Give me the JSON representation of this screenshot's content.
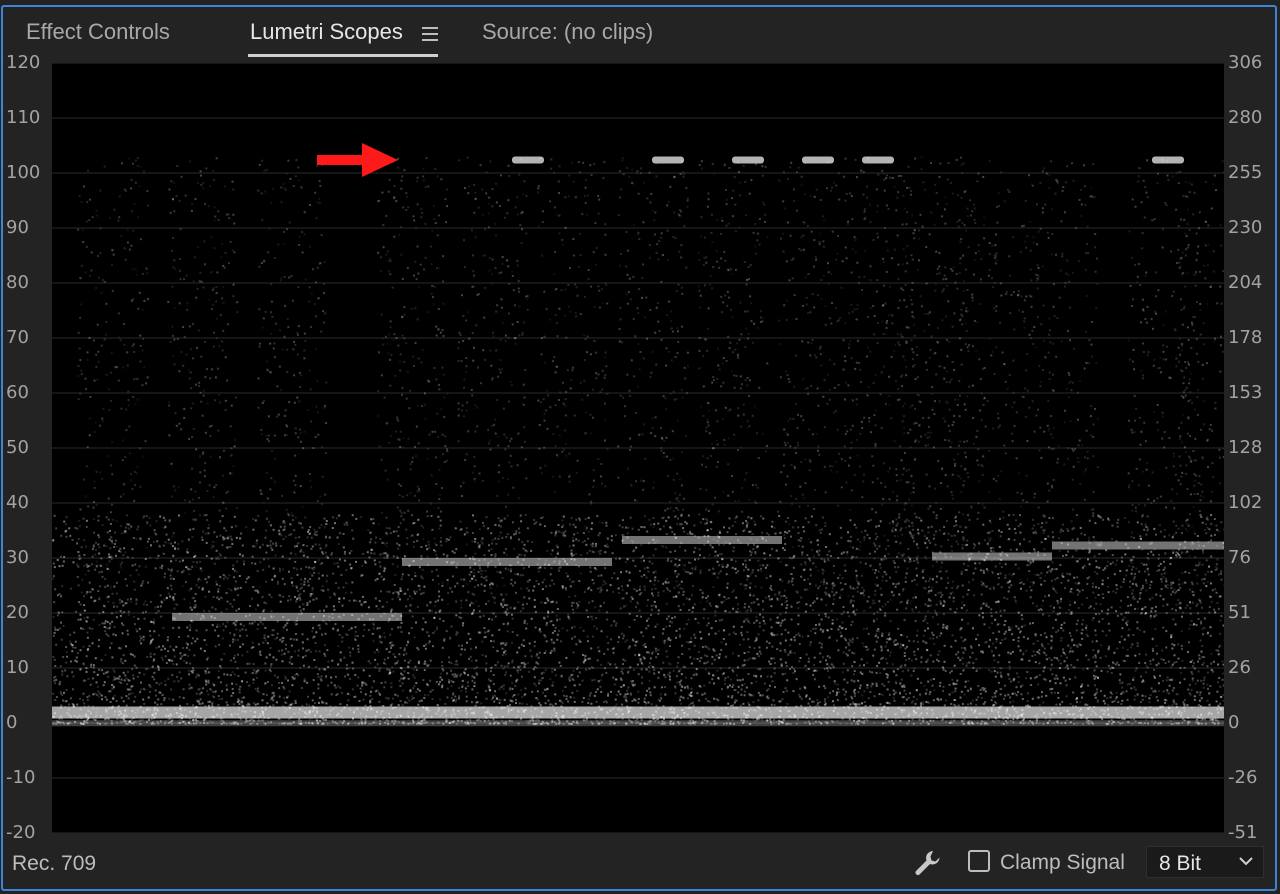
{
  "tabs": [
    {
      "label": "Effect Controls"
    },
    {
      "label": "Lumetri Scopes"
    },
    {
      "label": "Source: (no clips)"
    }
  ],
  "scope": {
    "left_scale": [
      "120",
      "110",
      "100",
      "90",
      "80",
      "70",
      "60",
      "50",
      "40",
      "30",
      "20",
      "10",
      "0",
      "-10",
      "-20"
    ],
    "right_scale": [
      "306",
      "280",
      "255",
      "230",
      "204",
      "178",
      "153",
      "128",
      "102",
      "76",
      "51",
      "26",
      "0",
      "-26",
      "-51"
    ]
  },
  "footer": {
    "standard": "Rec. 709",
    "clamp_label": "Clamp Signal",
    "clamp_checked": false,
    "bit_depth": "8 Bit"
  },
  "icons": {
    "menu": "hamburger-menu-icon",
    "settings": "wrench-icon",
    "dropdown": "chevron-down-icon",
    "annotation": "red-arrow-icon"
  },
  "colors": {
    "panel_border": "#3b86d6",
    "annotation": "#ff1a1a"
  }
}
